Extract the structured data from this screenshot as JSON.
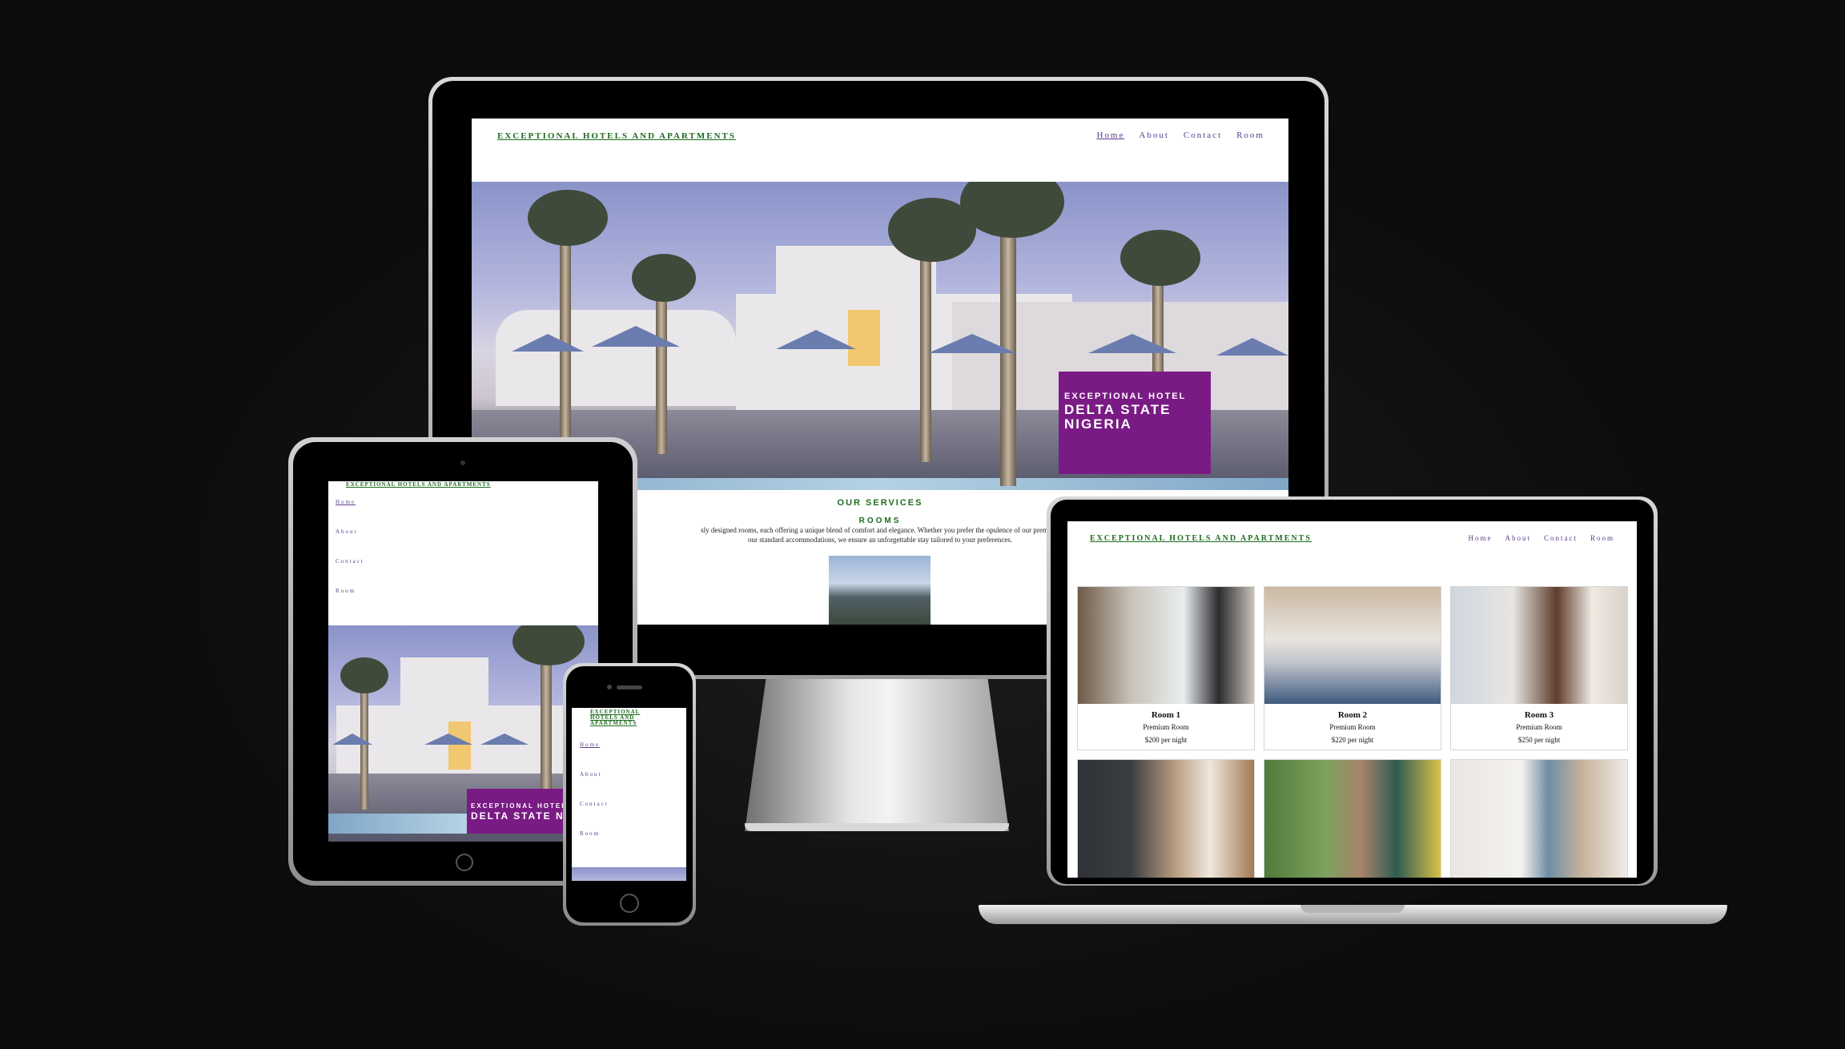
{
  "site": {
    "brand": "EXCEPTIONAL HOTELS AND APARTMENTS",
    "brand_line1": "EXCEPTIONAL",
    "brand_line2": "HOTELS AND",
    "brand_line3": "APARTMENTS",
    "nav": [
      {
        "label": "Home"
      },
      {
        "label": "About"
      },
      {
        "label": "Contact"
      },
      {
        "label": "Room"
      }
    ]
  },
  "hero": {
    "kicker": "EXCEPTIONAL HOTEL",
    "headline_line1": "DELTA STATE",
    "headline_line2": "NIGERIA",
    "headline_tablet": "DELTA STATE NIG"
  },
  "services": {
    "heading": "OUR SERVICES",
    "subheading": "ROOMS",
    "text_line1": "sly designed rooms, each offering a unique blend of comfort and elegance. Whether you prefer the opulence of our premium",
    "text_line2": "our standard accommodations, we ensure an unforgettable stay tailored to your preferences."
  },
  "rooms": [
    {
      "name": "Room 1",
      "type": "Premium Room",
      "price": "$200 per night"
    },
    {
      "name": "Room 2",
      "type": "Premium Room",
      "price": "$220 per night"
    },
    {
      "name": "Room 3",
      "type": "Premium Room",
      "price": "$250 per night"
    }
  ],
  "colors": {
    "background": "#0d0c0d",
    "brand_green": "#1f6b1f",
    "nav_purple": "#5b3a8e",
    "hero_box": "#7a1b85"
  }
}
